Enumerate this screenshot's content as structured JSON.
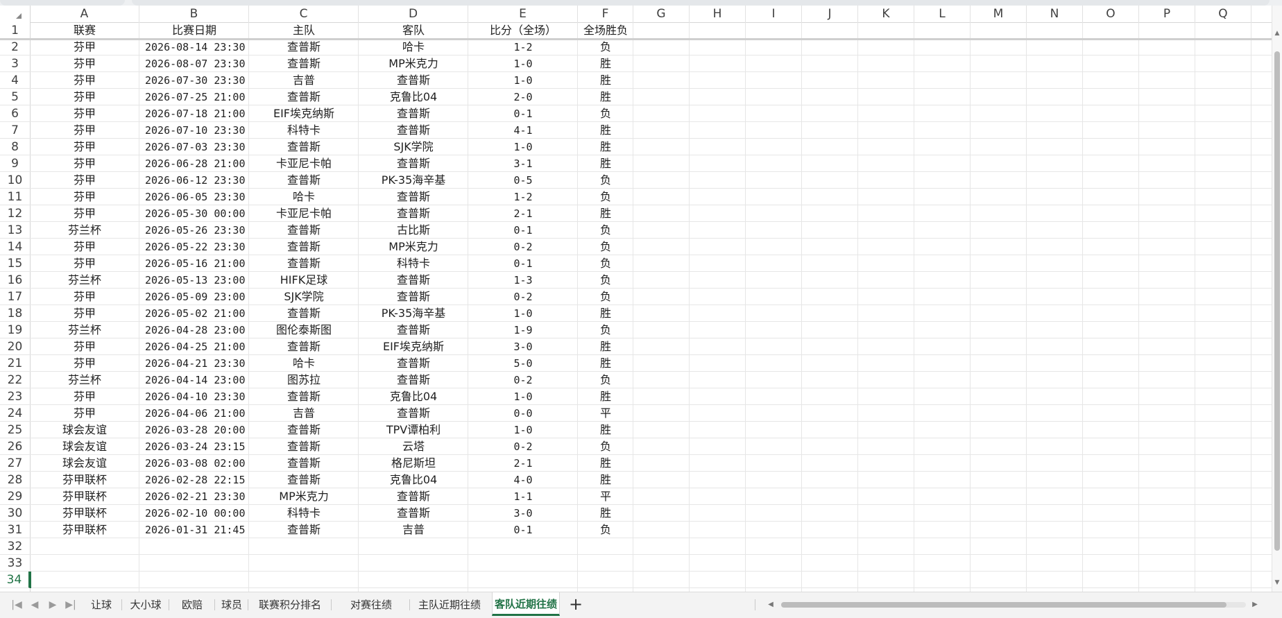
{
  "columns": [
    "A",
    "B",
    "C",
    "D",
    "E",
    "F",
    "G",
    "H",
    "I",
    "J",
    "K",
    "L",
    "M",
    "N",
    "O",
    "P",
    "Q"
  ],
  "row_numbers": [
    "1",
    "2",
    "3",
    "4",
    "5",
    "6",
    "7",
    "8",
    "9",
    "10",
    "11",
    "12",
    "13",
    "14",
    "15",
    "16",
    "17",
    "18",
    "19",
    "20",
    "21",
    "22",
    "23",
    "24",
    "25",
    "26",
    "27",
    "28",
    "29",
    "30",
    "31",
    "32",
    "33",
    "34"
  ],
  "headers": {
    "league": "联赛",
    "date": "比赛日期",
    "home": "主队",
    "away": "客队",
    "score": "比分（全场）",
    "result": "全场胜负"
  },
  "rows": [
    [
      "芬甲",
      "2026-08-14 23:30",
      "查普斯",
      "哈卡",
      "1-2",
      "负"
    ],
    [
      "芬甲",
      "2026-08-07 23:30",
      "查普斯",
      "MP米克力",
      "1-0",
      "胜"
    ],
    [
      "芬甲",
      "2026-07-30 23:30",
      "吉普",
      "查普斯",
      "1-0",
      "胜"
    ],
    [
      "芬甲",
      "2026-07-25 21:00",
      "查普斯",
      "克鲁比04",
      "2-0",
      "胜"
    ],
    [
      "芬甲",
      "2026-07-18 21:00",
      "EIF埃克纳斯",
      "查普斯",
      "0-1",
      "负"
    ],
    [
      "芬甲",
      "2026-07-10 23:30",
      "科特卡",
      "查普斯",
      "4-1",
      "胜"
    ],
    [
      "芬甲",
      "2026-07-03 23:30",
      "查普斯",
      "SJK学院",
      "1-0",
      "胜"
    ],
    [
      "芬甲",
      "2026-06-28 21:00",
      "卡亚尼卡帕",
      "查普斯",
      "3-1",
      "胜"
    ],
    [
      "芬甲",
      "2026-06-12 23:30",
      "查普斯",
      "PK-35海辛基",
      "0-5",
      "负"
    ],
    [
      "芬甲",
      "2026-06-05 23:30",
      "哈卡",
      "查普斯",
      "1-2",
      "负"
    ],
    [
      "芬甲",
      "2026-05-30 00:00",
      "卡亚尼卡帕",
      "查普斯",
      "2-1",
      "胜"
    ],
    [
      "芬兰杯",
      "2026-05-26 23:30",
      "查普斯",
      "古比斯",
      "0-1",
      "负"
    ],
    [
      "芬甲",
      "2026-05-22 23:30",
      "查普斯",
      "MP米克力",
      "0-2",
      "负"
    ],
    [
      "芬甲",
      "2026-05-16 21:00",
      "查普斯",
      "科特卡",
      "0-1",
      "负"
    ],
    [
      "芬兰杯",
      "2026-05-13 23:00",
      "HIFK足球",
      "查普斯",
      "1-3",
      "负"
    ],
    [
      "芬甲",
      "2026-05-09 23:00",
      "SJK学院",
      "查普斯",
      "0-2",
      "负"
    ],
    [
      "芬甲",
      "2026-05-02 21:00",
      "查普斯",
      "PK-35海辛基",
      "1-0",
      "胜"
    ],
    [
      "芬兰杯",
      "2026-04-28 23:00",
      "图伦泰斯图",
      "查普斯",
      "1-9",
      "负"
    ],
    [
      "芬甲",
      "2026-04-25 21:00",
      "查普斯",
      "EIF埃克纳斯",
      "3-0",
      "胜"
    ],
    [
      "芬甲",
      "2026-04-21 23:30",
      "哈卡",
      "查普斯",
      "5-0",
      "胜"
    ],
    [
      "芬兰杯",
      "2026-04-14 23:00",
      "图苏拉",
      "查普斯",
      "0-2",
      "负"
    ],
    [
      "芬甲",
      "2026-04-10 23:30",
      "查普斯",
      "克鲁比04",
      "1-0",
      "胜"
    ],
    [
      "芬甲",
      "2026-04-06 21:00",
      "吉普",
      "查普斯",
      "0-0",
      "平"
    ],
    [
      "球会友谊",
      "2026-03-28 20:00",
      "查普斯",
      "TPV谭柏利",
      "1-0",
      "胜"
    ],
    [
      "球会友谊",
      "2026-03-24 23:15",
      "查普斯",
      "云塔",
      "0-2",
      "负"
    ],
    [
      "球会友谊",
      "2026-03-08 02:00",
      "查普斯",
      "格尼斯坦",
      "2-1",
      "胜"
    ],
    [
      "芬甲联杯",
      "2026-02-28 22:15",
      "查普斯",
      "克鲁比04",
      "4-0",
      "胜"
    ],
    [
      "芬甲联杯",
      "2026-02-21 23:30",
      "MP米克力",
      "查普斯",
      "1-1",
      "平"
    ],
    [
      "芬甲联杯",
      "2026-02-10 00:00",
      "科特卡",
      "查普斯",
      "3-0",
      "胜"
    ],
    [
      "芬甲联杯",
      "2026-01-31 21:45",
      "查普斯",
      "吉普",
      "0-1",
      "负"
    ]
  ],
  "sheet_tabs": [
    "让球",
    "大小球",
    "欧赔",
    "球员",
    "联赛积分排名",
    "对赛往绩",
    "主队近期往绩",
    "客队近期往绩"
  ],
  "active_tab": "客队近期往绩",
  "active_row": "34",
  "colors": {
    "accent": "#217346",
    "grid": "#e6e6e6",
    "header_text": "#404040"
  }
}
